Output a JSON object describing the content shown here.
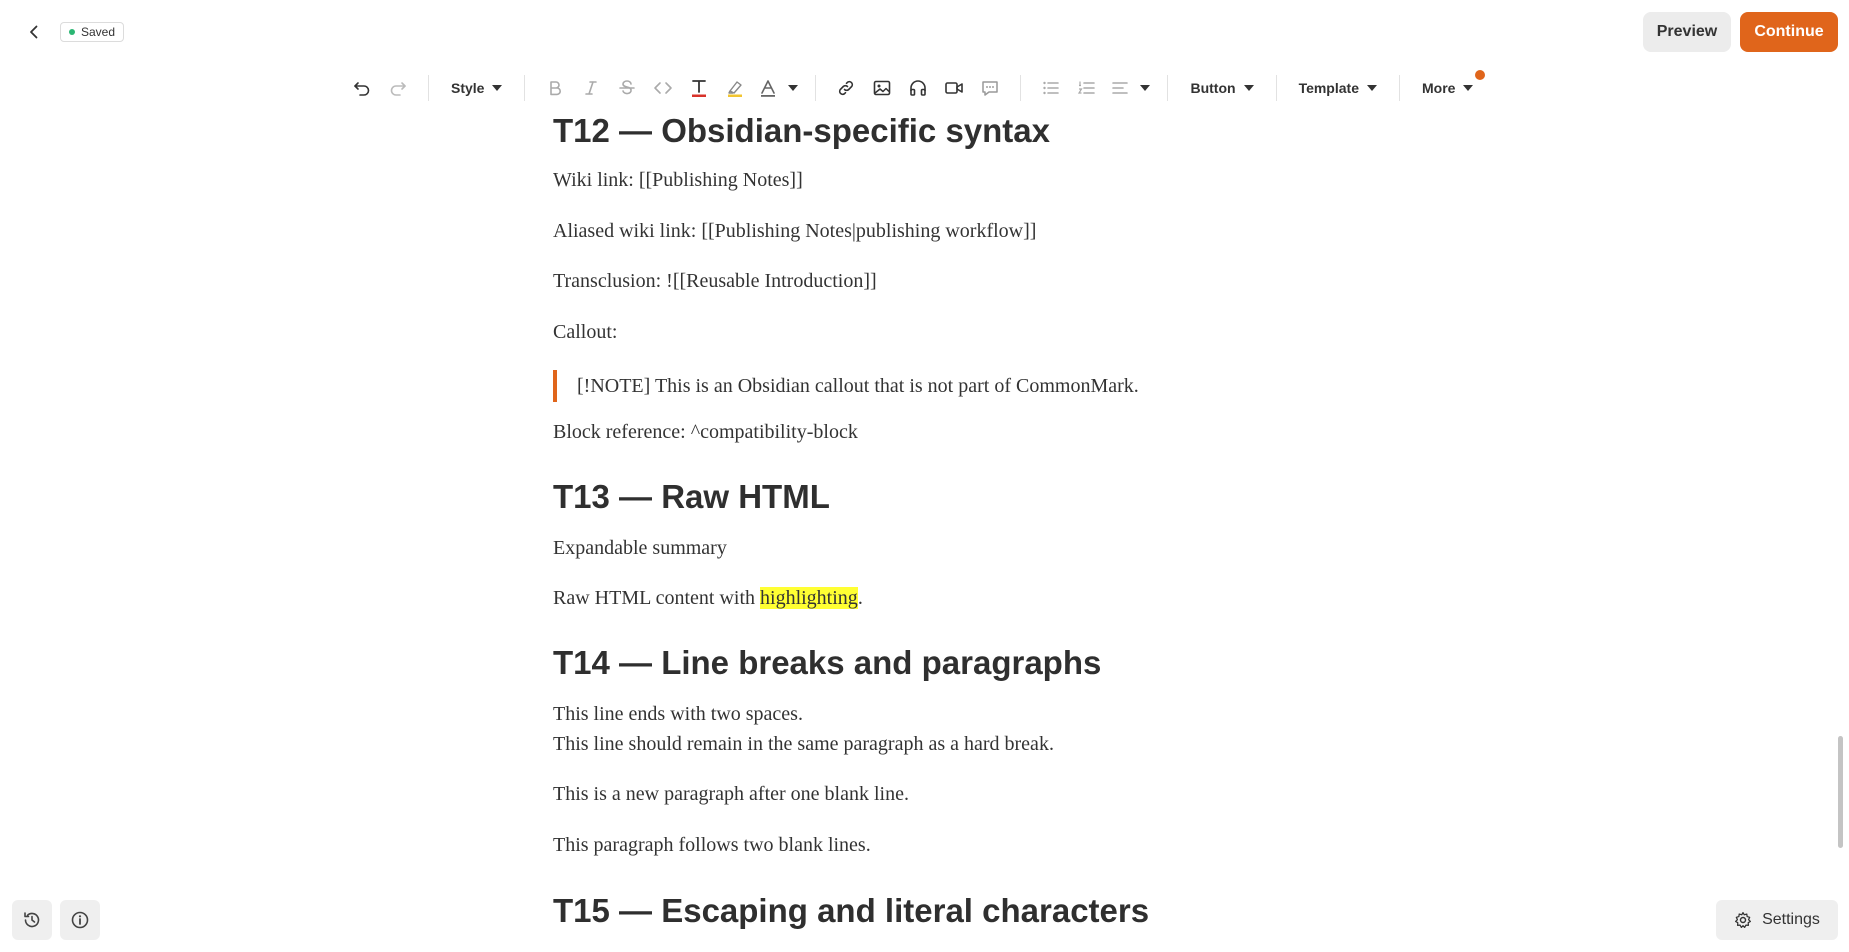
{
  "header": {
    "saved_label": "Saved",
    "preview_label": "Preview",
    "continue_label": "Continue",
    "accent_color": "#e0651b"
  },
  "toolbar": {
    "style_label": "Style",
    "button_label": "Button",
    "template_label": "Template",
    "more_label": "More"
  },
  "document": {
    "t12": {
      "heading": "T12 — Obsidian-specific syntax",
      "wiki_link": "Wiki link: [[Publishing Notes]]",
      "aliased_wiki_link": "Aliased wiki link: [[Publishing Notes|publishing workflow]]",
      "transclusion": "Transclusion: ![[Reusable Introduction]]",
      "callout_label": "Callout:",
      "callout_text": "[!NOTE] This is an Obsidian callout that is not part of CommonMark.",
      "block_reference": "Block reference: ^compatibility-block"
    },
    "t13": {
      "heading": "T13 — Raw HTML",
      "summary": "Expandable summary",
      "raw_prefix": "Raw HTML content with ",
      "raw_highlight": "highlighting",
      "raw_suffix": "."
    },
    "t14": {
      "heading": "T14 — Line breaks and paragraphs",
      "line1": "This line ends with two spaces.",
      "line2": "This line should remain in the same paragraph as a hard break.",
      "para2": "This is a new paragraph after one blank line.",
      "para3": "This paragraph follows two blank lines."
    },
    "t15": {
      "heading": "T15 — Escaping and literal characters"
    }
  },
  "footer": {
    "settings_label": "Settings"
  }
}
